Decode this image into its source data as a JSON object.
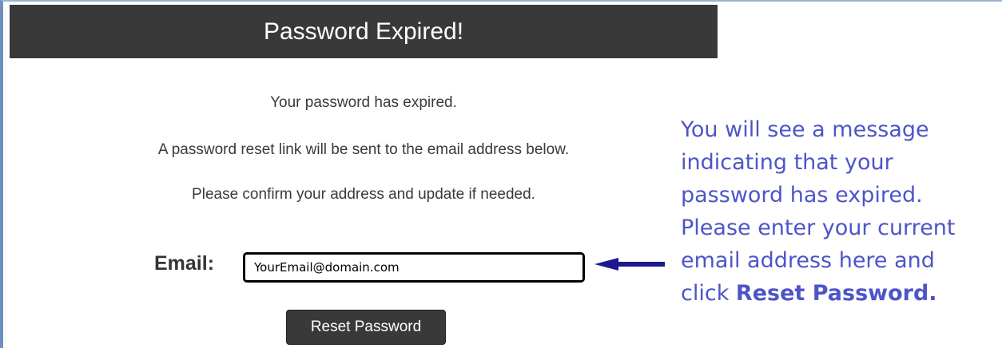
{
  "header": {
    "title": "Password Expired!"
  },
  "messages": {
    "line1": "Your password has expired.",
    "line2": "A password reset link will be sent to the email address below.",
    "line3": "Please confirm your address and update if needed."
  },
  "form": {
    "email_label": "Email:",
    "email_value": "YourEmail@domain.com",
    "reset_button_label": "Reset Password"
  },
  "annotation": {
    "lines": [
      "You will see a message",
      "indicating that your",
      "password has expired.",
      "Please enter your current",
      "email address here and"
    ],
    "last_line_prefix": "click ",
    "last_line_bold": "Reset Password.",
    "arrow_icon": "arrow-left-icon",
    "color": "#4d55c8"
  },
  "colors": {
    "header_bg": "#393939",
    "button_bg": "#393939",
    "arrow": "#1a1a8c"
  }
}
